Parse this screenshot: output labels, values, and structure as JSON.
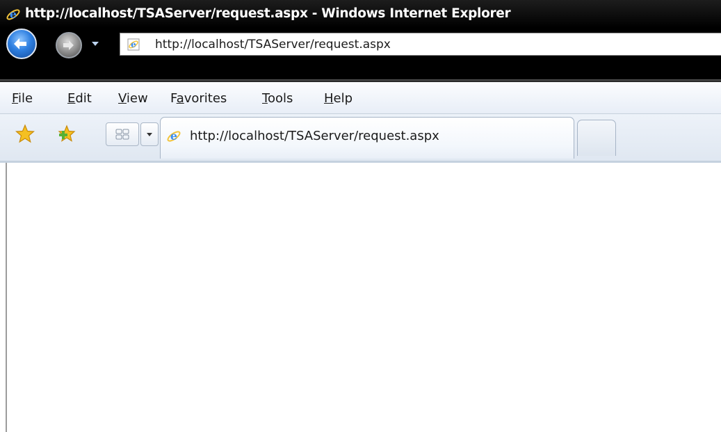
{
  "window": {
    "title": "http://localhost/TSAServer/request.aspx - Windows Internet Explorer"
  },
  "navigation": {
    "back_icon": "back-arrow-icon",
    "forward_icon": "forward-arrow-icon",
    "recent_pages_icon": "chevron-down-icon",
    "address": "http://localhost/TSAServer/request.aspx"
  },
  "menu": {
    "items": [
      {
        "label": "File",
        "accel": "F",
        "rest": "ile"
      },
      {
        "label": "Edit",
        "accel": "E",
        "rest": "dit"
      },
      {
        "label": "View",
        "accel": "V",
        "rest": "iew"
      },
      {
        "label": "Favorites",
        "pre": "F",
        "accel": "a",
        "rest": "vorites"
      },
      {
        "label": "Tools",
        "accel": "T",
        "rest": "ools"
      },
      {
        "label": "Help",
        "accel": "H",
        "rest": "elp"
      }
    ]
  },
  "toolbar": {
    "favorites_icon": "favorites-star-icon",
    "add_favorites_icon": "add-favorites-star-icon",
    "quick_tabs_icon": "quick-tabs-icon",
    "tab_list_icon": "chevron-down-icon"
  },
  "tabs": {
    "active": "http://localhost/TSAServer/request.aspx"
  },
  "colors": {
    "titlebar": "#000000",
    "menubar": "#eef2f8",
    "ie_blue": "#1d6fd1",
    "star_gold": "#f2b51a",
    "star_green": "#58b135"
  }
}
